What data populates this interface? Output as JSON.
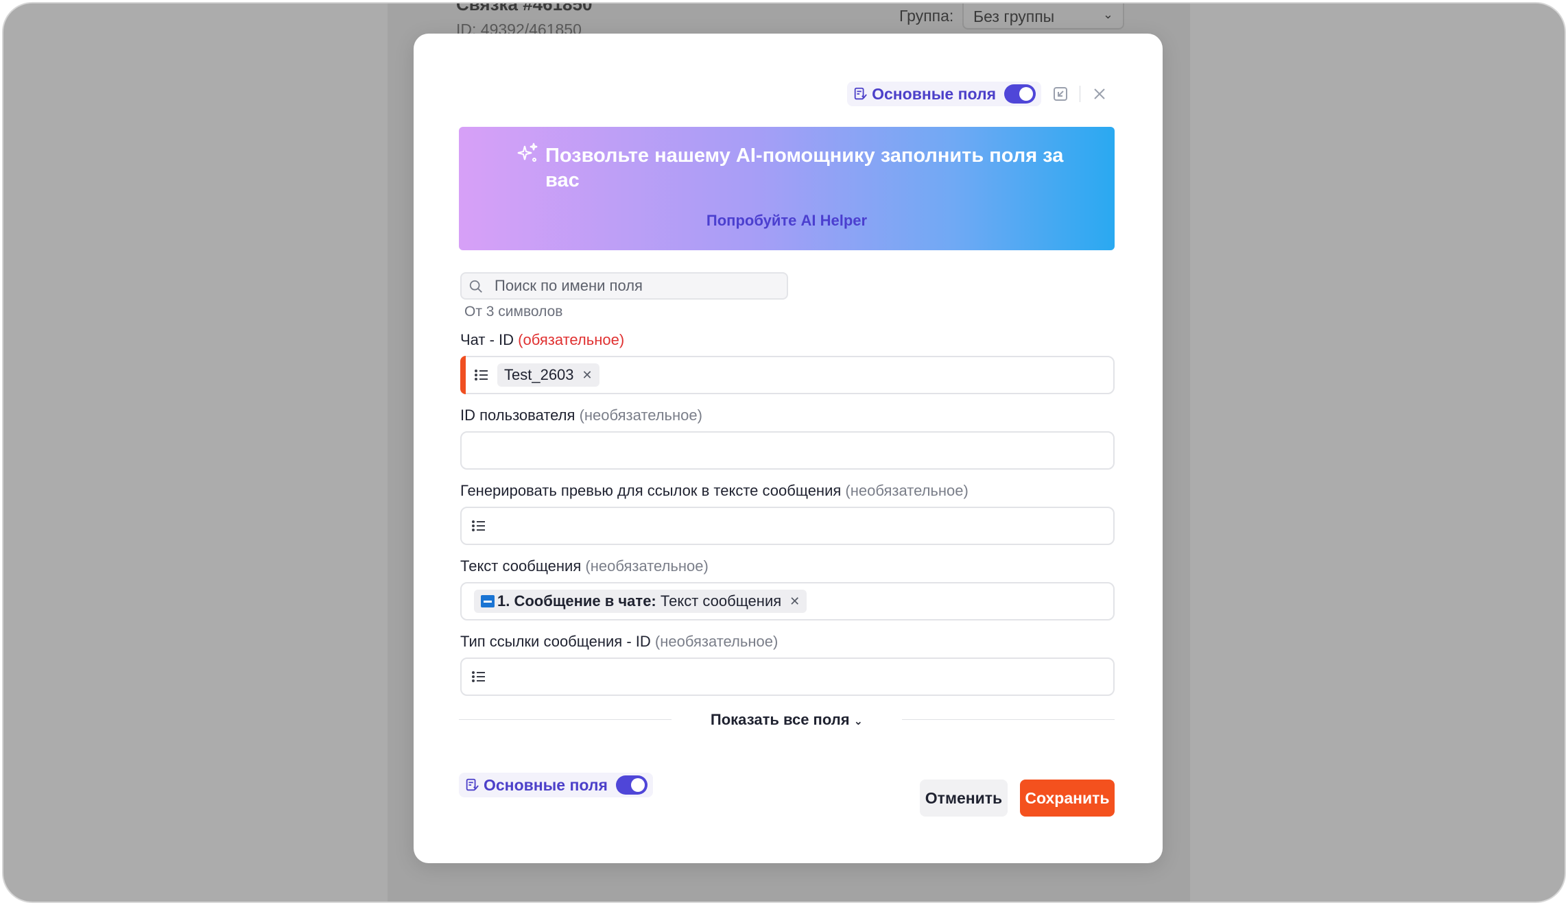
{
  "background": {
    "title": "Связка #461850",
    "id_line": "ID: 49392/461850",
    "group_label": "Группа:",
    "group_value": "Без группы"
  },
  "header": {
    "fields_toggle_label": "Основные поля",
    "fields_toggle_on": true,
    "icons": [
      "fields-doc-icon",
      "collapse-icon",
      "close-icon"
    ]
  },
  "ai_banner": {
    "title": "Позвольте нашему AI-помощнику заполнить поля за вас",
    "link": "Попробуйте AI Helper",
    "icon": "sparkle-icon"
  },
  "search": {
    "placeholder": "Поиск по имени поля",
    "value": "",
    "hint": "От 3 символов"
  },
  "fields": [
    {
      "label": "Чат - ID",
      "qualifier": "(обязательное)",
      "required": true,
      "tag": "Test_2603"
    },
    {
      "label": "ID пользователя",
      "qualifier": "(необязательное)",
      "required": false
    },
    {
      "label": "Генерировать превью для ссылок в тексте сообщения",
      "qualifier": "(необязательное)",
      "required": false
    },
    {
      "label": "Текст сообщения",
      "qualifier": "(необязательное)",
      "required": false,
      "tag_bold": "1. Сообщение в чате:",
      "tag_rest": "Текст сообщения"
    },
    {
      "label": "Тип ссылки сообщения - ID",
      "qualifier": "(необязательное)",
      "required": false
    }
  ],
  "show_all": "Показать все поля",
  "footer": {
    "fields_toggle_label": "Основные поля",
    "cancel": "Отменить",
    "save": "Сохранить"
  },
  "colors": {
    "accent": "#4f46d8",
    "save_button": "#f4511e",
    "required_marker": "#e03131"
  }
}
